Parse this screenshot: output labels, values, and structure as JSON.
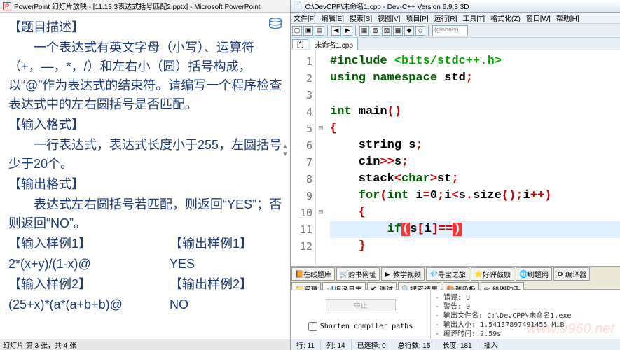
{
  "powerpoint": {
    "title": "PowerPoint 幻灯片放映 - [11.13.3表达式括号匹配2.pptx] - Microsoft PowerPoint",
    "problem": {
      "h1": "【题目描述】",
      "p1": "一个表达式有英文字母（小写）、运算符（+，—，*，/）和左右小（圆）括号构成，以“@”作为表达式的结束符。请编写一个程序检查表达式中的左右圆括号是否匹配。",
      "h2": "【输入格式】",
      "p2": "一行表达式，表达式长度小于255，左圆括号少于20个。",
      "h3": "【输出格式】",
      "p3": "表达式左右圆括号若匹配，则返回“YES”；否则返回“NO”。",
      "s1l": "【输入样例1】",
      "s1r": "【输出样例1】",
      "s1lv": "2*(x+y)/(1-x)@",
      "s1rv": "YES",
      "s2l": "【输入样例2】",
      "s2r": "【输出样例2】",
      "s2lv": "(25+x)*(a*(a+b+b)@",
      "s2rv": "NO"
    },
    "status": "幻灯片 第 3 张，共 4 张"
  },
  "devcpp": {
    "title": "C:\\DevCPP\\未命名1.cpp - Dev-C++ Version 6.9.3  3D",
    "menu": [
      "文件[F]",
      "编辑[E]",
      "搜索[S]",
      "视图[V]",
      "项目[P]",
      "运行[R]",
      "工具[T]",
      "格式化(Z)",
      "窗口[W]",
      "帮助[H]"
    ],
    "combo": "(globals)",
    "tab_x": "[*]",
    "tab": "未命名1.cpp",
    "lines": [
      "1",
      "2",
      "3",
      "4",
      "5",
      "6",
      "7",
      "8",
      "9",
      "10",
      "11",
      "12"
    ],
    "code": {
      "l1a": "#include ",
      "l1b": "<bits/stdc++.h>",
      "l2a": "using ",
      "l2b": "namespace",
      "l2c": " std",
      "l2d": ";",
      "l4a": "int",
      "l4b": " main",
      "l4c": "()",
      "l5": "{",
      "l6a": "    s",
      "l6b": "tr",
      "l6c": "ing s",
      "l6d": ";",
      "l7a": "    cin",
      "l7b": ">>",
      "l7c": "s",
      "l7d": ";",
      "l8a": "    stack",
      "l8b": "<",
      "l8c": "char",
      "l8d": ">",
      "l8e": "st",
      "l8f": ";",
      "l9a": "    ",
      "l9b": "for",
      "l9c": "(",
      "l9d": "int",
      "l9e": " i",
      "l9f": "=",
      "l9g": "0",
      "l9h": ";",
      "l9i": "i",
      "l9j": "<",
      "l9k": "s",
      "l9l": ".",
      "l9m": "size",
      "l9n": "();",
      "l9o": "i",
      "l9p": "++",
      "l9q": ")",
      "l10": "    {",
      "l11a": "        ",
      "l11b": "if",
      "l11c": "(",
      "l11d": "s",
      "l11e": "[",
      "l11f": "i",
      "l11g": "]==",
      "l11h": ")",
      "l12": "    }"
    },
    "bottom_tabs": [
      "在线题库",
      "购书网址",
      "教学视频",
      "寻宝之旅",
      "好评鼓励",
      "刷题网",
      "编译器",
      "资源",
      "编译日志",
      "调试",
      "搜索结果",
      "调色板",
      "绘图助手"
    ],
    "compiler": {
      "stop": "中止",
      "chk": "Shorten compiler paths",
      "out1": "- 错误: 0",
      "out2": "- 警告: 0",
      "out3": "- 输出文件名: C:\\DevCPP\\未命名1.exe",
      "out4": "- 输出大小: 1.54137897491455 MiB",
      "out5": "- 编译时间: 2.59s"
    },
    "status": {
      "line": "行: 11",
      "col": "列: 14",
      "sel": "已选择: 0",
      "total": "总行数: 15",
      "len": "长度: 181",
      "ins": "插入"
    }
  },
  "watermark": "www.9960.net"
}
